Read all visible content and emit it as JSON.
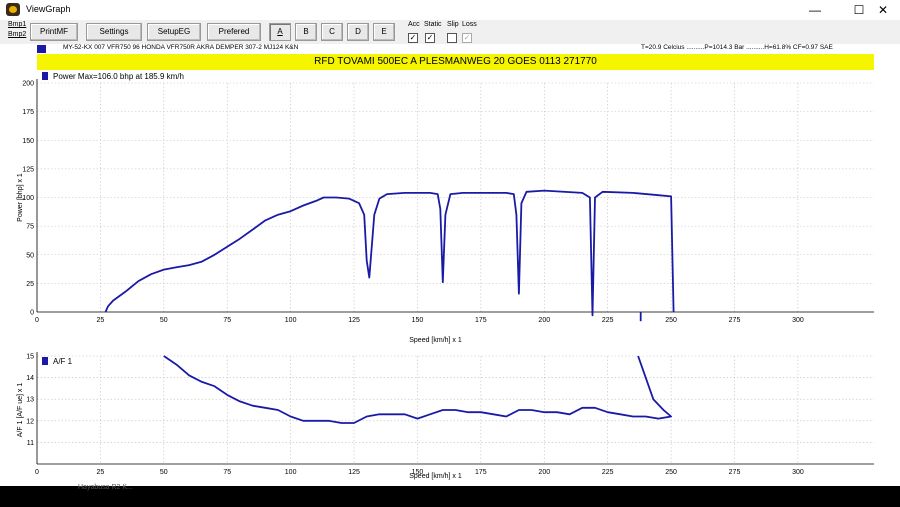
{
  "window": {
    "title": "ViewGraph",
    "minimize_glyph": "—",
    "maximize_glyph": "☐",
    "close_glyph": "✕"
  },
  "toolbar": {
    "bmp1": "Bmp1",
    "bmp2": "Bmp2",
    "buttons": [
      "PrintMF",
      "Settings",
      "SetupEG",
      "Prefered",
      "A",
      "B",
      "C",
      "D",
      "E"
    ],
    "checks": [
      {
        "label": "Acc",
        "checked": true
      },
      {
        "label": "Static",
        "checked": true
      },
      {
        "label": "Slip",
        "checked": false
      },
      {
        "label": "Loss",
        "checked": true
      }
    ],
    "check_mark": "✓"
  },
  "info": {
    "vehicle": "MY-52-KX 007 VFR750 96   HONDA VFR750R AKRA DEMPER 307-2 MJ124 K&N",
    "conditions": "T=20.9 Celcius ..........P=1014.3 Bar ..........H=61.8% CF=0.97 SAE"
  },
  "banner": "RFD TOVAMI 500EC  A  PLESMANWEG 20 GOES 0113 271770",
  "bottom_text": "Hayabusa R2 K...",
  "colors": {
    "accent": "#1a1aa6",
    "banner": "#f5f500"
  },
  "chart_data": [
    {
      "type": "line",
      "legend": "Power Max=106.0 bhp at 185.9 km/h",
      "xlabel": "Speed [km/h] x 1",
      "ylabel": "Power [bhp] x 1",
      "xlim": [
        0,
        330
      ],
      "ylim": [
        0,
        200
      ],
      "xticks": [
        0,
        25,
        50,
        75,
        100,
        125,
        150,
        175,
        200,
        225,
        250,
        275,
        300
      ],
      "yticks": [
        0,
        25,
        50,
        75,
        100,
        125,
        150,
        175,
        200
      ],
      "grid": true,
      "series": [
        {
          "name": "Power",
          "color": "#1a1aa6",
          "points": [
            [
              27,
              0
            ],
            [
              28,
              5
            ],
            [
              30,
              10
            ],
            [
              35,
              18
            ],
            [
              40,
              27
            ],
            [
              45,
              33
            ],
            [
              50,
              37
            ],
            [
              55,
              39
            ],
            [
              60,
              41
            ],
            [
              65,
              44
            ],
            [
              70,
              50
            ],
            [
              75,
              57
            ],
            [
              80,
              64
            ],
            [
              85,
              72
            ],
            [
              90,
              80
            ],
            [
              95,
              85
            ],
            [
              100,
              88
            ],
            [
              105,
              93
            ],
            [
              110,
              97
            ],
            [
              113,
              100
            ],
            [
              118,
              100
            ],
            [
              123,
              99
            ],
            [
              127,
              95
            ],
            [
              129,
              85
            ],
            [
              130,
              45
            ],
            [
              131,
              30
            ],
            [
              133,
              85
            ],
            [
              135,
              99
            ],
            [
              138,
              103
            ],
            [
              145,
              104
            ],
            [
              155,
              104
            ],
            [
              158,
              103
            ],
            [
              159,
              90
            ],
            [
              160,
              26
            ],
            [
              161,
              85
            ],
            [
              163,
              103
            ],
            [
              168,
              104
            ],
            [
              185,
              104
            ],
            [
              188,
              103
            ],
            [
              189,
              85
            ],
            [
              190,
              16
            ],
            [
              191,
              95
            ],
            [
              193,
              105
            ],
            [
              200,
              106
            ],
            [
              215,
              104
            ],
            [
              218,
              100
            ],
            [
              219,
              -3
            ],
            [
              220,
              100
            ],
            [
              223,
              105
            ],
            [
              235,
              104
            ],
            [
              245,
              102
            ],
            [
              250,
              101
            ],
            [
              251,
              0
            ]
          ]
        },
        {
          "name": "Power spike",
          "color": "#1a1aa6",
          "points": [
            [
              238,
              0
            ],
            [
              238,
              -8
            ]
          ]
        }
      ]
    },
    {
      "type": "line",
      "legend": "A/F 1",
      "xlabel": "Speed [km/h] x 1",
      "ylabel": "A/F 1 [A/F ue] x 1",
      "xlim": [
        0,
        330
      ],
      "ylim": [
        10,
        15
      ],
      "xticks": [
        0,
        25,
        50,
        75,
        100,
        125,
        150,
        175,
        200,
        225,
        250,
        275,
        300
      ],
      "yticks": [
        11,
        12,
        13,
        14,
        15
      ],
      "grid": true,
      "series": [
        {
          "name": "A/F 1",
          "color": "#1a1aa6",
          "points": [
            [
              50,
              15.0
            ],
            [
              55,
              14.6
            ],
            [
              60,
              14.1
            ],
            [
              65,
              13.8
            ],
            [
              70,
              13.6
            ],
            [
              75,
              13.2
            ],
            [
              80,
              12.9
            ],
            [
              85,
              12.7
            ],
            [
              90,
              12.6
            ],
            [
              95,
              12.5
            ],
            [
              100,
              12.2
            ],
            [
              105,
              12.0
            ],
            [
              110,
              12.0
            ],
            [
              115,
              12.0
            ],
            [
              120,
              11.9
            ],
            [
              125,
              11.9
            ],
            [
              130,
              12.2
            ],
            [
              135,
              12.3
            ],
            [
              140,
              12.3
            ],
            [
              145,
              12.3
            ],
            [
              150,
              12.1
            ],
            [
              155,
              12.3
            ],
            [
              160,
              12.5
            ],
            [
              165,
              12.5
            ],
            [
              170,
              12.4
            ],
            [
              175,
              12.4
            ],
            [
              180,
              12.3
            ],
            [
              185,
              12.2
            ],
            [
              190,
              12.5
            ],
            [
              195,
              12.5
            ],
            [
              200,
              12.4
            ],
            [
              205,
              12.4
            ],
            [
              210,
              12.3
            ],
            [
              215,
              12.6
            ],
            [
              220,
              12.6
            ],
            [
              225,
              12.4
            ],
            [
              230,
              12.3
            ],
            [
              235,
              12.2
            ],
            [
              240,
              12.2
            ],
            [
              245,
              12.1
            ],
            [
              250,
              12.2
            ],
            [
              247,
              12.5
            ],
            [
              243,
              13.0
            ],
            [
              240,
              14.0
            ],
            [
              237,
              15.0
            ]
          ]
        }
      ]
    }
  ]
}
